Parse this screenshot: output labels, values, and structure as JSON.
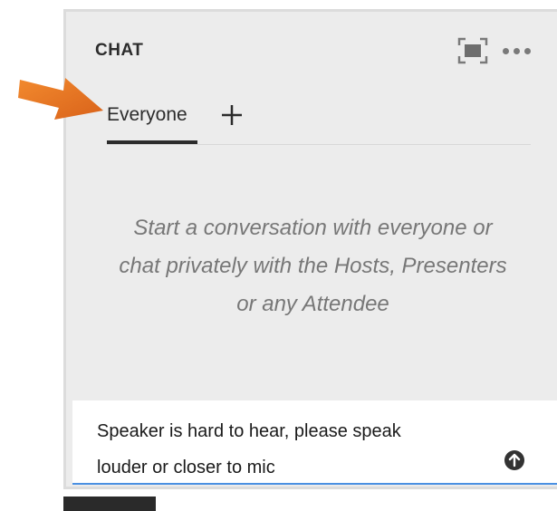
{
  "panel": {
    "title": "CHAT",
    "maximize_icon": "maximize-icon",
    "more_icon": "more-options-icon"
  },
  "tabs": [
    {
      "label": "Everyone",
      "selected": true
    }
  ],
  "add_tab_icon": "plus-icon",
  "empty_state": {
    "line1": "Start a conversation with everyone or",
    "line2": "chat privately with the Hosts, Presenters",
    "line3": "or any Attendee"
  },
  "composer": {
    "value": "Speaker is hard to hear, please speak\nlouder or closer to mic",
    "send_icon": "send-arrow-up-icon",
    "focus_color": "#4a90e2"
  },
  "colors": {
    "arrow": "#e8731f",
    "panel_bg": "#ececec",
    "text": "#2c2c2c",
    "muted_text": "#777777"
  }
}
